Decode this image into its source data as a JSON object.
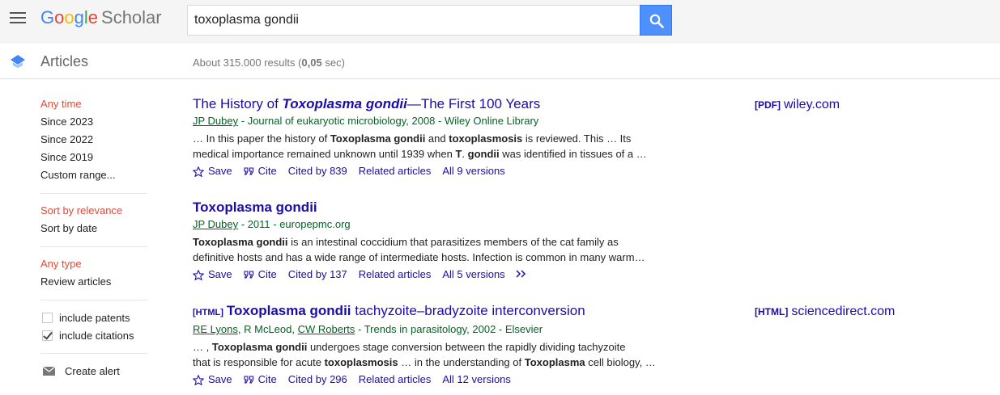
{
  "header": {
    "logo_letters": [
      {
        "ch": "G",
        "color": "#4285f4"
      },
      {
        "ch": "o",
        "color": "#ea4335"
      },
      {
        "ch": "o",
        "color": "#fbbc05"
      },
      {
        "ch": "g",
        "color": "#4285f4"
      },
      {
        "ch": "l",
        "color": "#34a853"
      },
      {
        "ch": "e",
        "color": "#ea4335"
      }
    ],
    "logo_suffix": "Scholar",
    "search_value": "toxoplasma gondii",
    "menu_icon": "hamburger-menu-icon",
    "search_icon": "search-icon",
    "accent_color": "#4d90fe"
  },
  "subbar": {
    "section_label": "Articles",
    "stats_prefix": "About 315.000 results (",
    "stats_time": "0,05",
    "stats_suffix": " sec)"
  },
  "sidebar": {
    "time_filters": [
      "Any time",
      "Since 2023",
      "Since 2022",
      "Since 2019",
      "Custom range..."
    ],
    "sort_options": [
      "Sort by relevance",
      "Sort by date"
    ],
    "type_filters": [
      "Any type",
      "Review articles"
    ],
    "checkboxes": [
      {
        "label": "include patents",
        "checked": false
      },
      {
        "label": "include citations",
        "checked": true
      }
    ],
    "alert_label": "Create alert",
    "active_color": "#dd4b39"
  },
  "results": [
    {
      "tag": "",
      "title_parts": [
        {
          "text": "The History of ",
          "style": "normal"
        },
        {
          "text": "Toxoplasma gondii",
          "style": "bolditalic"
        },
        {
          "text": "—The First 100 Years",
          "style": "normal"
        }
      ],
      "meta_parts": [
        {
          "text": "JP Dubey",
          "link": true
        },
        {
          "text": " - Journal of eukaryotic microbiology, 2008 - Wiley Online Library",
          "link": false
        }
      ],
      "snippet_lines": [
        [
          {
            "t": "… In this paper the history of ",
            "b": false
          },
          {
            "t": "Toxoplasma gondii",
            "b": true
          },
          {
            "t": " and ",
            "b": false
          },
          {
            "t": "toxoplasmosis",
            "b": true
          },
          {
            "t": " is reviewed. This … Its",
            "b": false
          }
        ],
        [
          {
            "t": "medical importance remained unknown until 1939 when ",
            "b": false
          },
          {
            "t": "T",
            "b": true
          },
          {
            "t": ". ",
            "b": false
          },
          {
            "t": "gondii",
            "b": true
          },
          {
            "t": " was identified in tissues of a …",
            "b": false
          }
        ]
      ],
      "actions": [
        "Save",
        "Cite",
        "Cited by 839",
        "Related articles",
        "All 9 versions"
      ],
      "show_more": false,
      "side_tag": "[PDF]",
      "side_domain": "wiley.com"
    },
    {
      "tag": "",
      "title_parts": [
        {
          "text": "Toxoplasma gondii",
          "style": "bold"
        }
      ],
      "meta_parts": [
        {
          "text": "JP Dubey",
          "link": true
        },
        {
          "text": " - 2011 - europepmc.org",
          "link": false
        }
      ],
      "snippet_lines": [
        [
          {
            "t": "Toxoplasma gondii",
            "b": true
          },
          {
            "t": " is an intestinal coccidium that parasitizes members of the cat family as",
            "b": false
          }
        ],
        [
          {
            "t": "definitive hosts and has a wide range of intermediate hosts. Infection is common in many warm…",
            "b": false
          }
        ]
      ],
      "actions": [
        "Save",
        "Cite",
        "Cited by 137",
        "Related articles",
        "All 5 versions"
      ],
      "show_more": true,
      "side_tag": "",
      "side_domain": ""
    },
    {
      "tag": "[HTML]",
      "title_parts": [
        {
          "text": "Toxoplasma gondii",
          "style": "bold"
        },
        {
          "text": " tachyzoite–bradyzoite interconversion",
          "style": "normal"
        }
      ],
      "meta_parts": [
        {
          "text": "RE Lyons",
          "link": true
        },
        {
          "text": ", R McLeod, ",
          "link": false
        },
        {
          "text": "CW Roberts",
          "link": true
        },
        {
          "text": " - Trends in parasitology, 2002 - Elsevier",
          "link": false
        }
      ],
      "snippet_lines": [
        [
          {
            "t": "… , ",
            "b": false
          },
          {
            "t": "Toxoplasma gondii",
            "b": true
          },
          {
            "t": " undergoes stage conversion between the rapidly dividing tachyzoite",
            "b": false
          }
        ],
        [
          {
            "t": "that is responsible for acute ",
            "b": false
          },
          {
            "t": "toxoplasmosis",
            "b": true
          },
          {
            "t": " … in the understanding of ",
            "b": false
          },
          {
            "t": "Toxoplasma",
            "b": true
          },
          {
            "t": " cell biology, …",
            "b": false
          }
        ]
      ],
      "actions": [
        "Save",
        "Cite",
        "Cited by 296",
        "Related articles",
        "All 12 versions"
      ],
      "show_more": false,
      "side_tag": "[HTML]",
      "side_domain": "sciencedirect.com"
    }
  ]
}
